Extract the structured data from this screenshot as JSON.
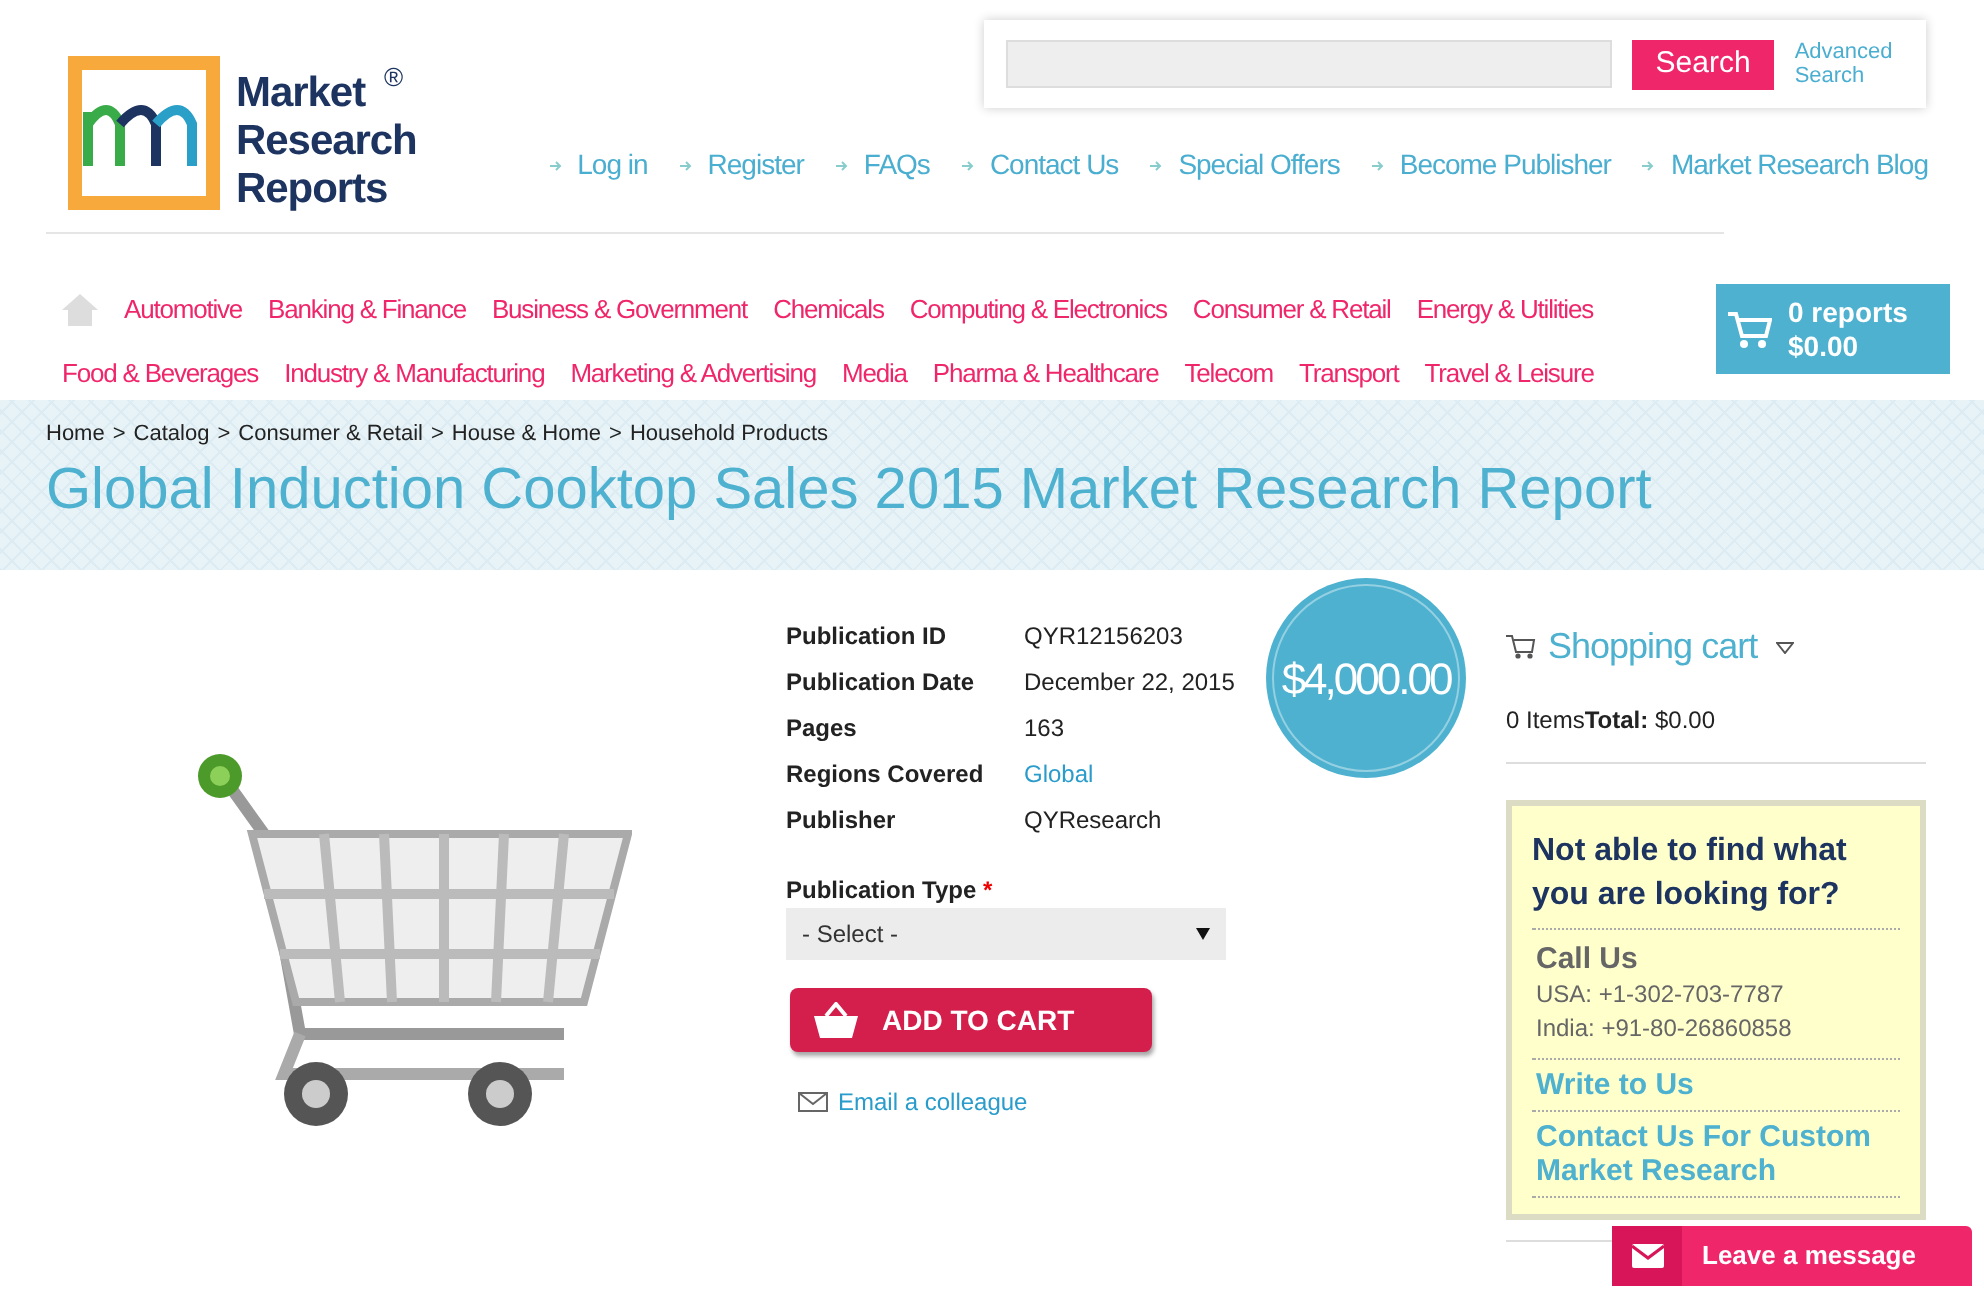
{
  "logo": {
    "line_1": "Market",
    "line_2": "Research",
    "line_3": "Reports",
    "mark": "®"
  },
  "search": {
    "button": "Search",
    "advanced": "Advanced Search"
  },
  "top_links": [
    "Log in",
    "Register",
    "FAQs",
    "Contact Us",
    "Special Offers",
    "Become Publisher",
    "Market Research Blog"
  ],
  "categories": [
    [
      "Automotive",
      "Banking & Finance",
      "Business & Government",
      "Chemicals",
      "Computing & Electronics",
      "Consumer & Retail",
      "Energy & Utilities"
    ],
    [
      "Food & Beverages",
      "Industry & Manufacturing",
      "Marketing & Advertising",
      "Media",
      "Pharma & Healthcare",
      "Telecom",
      "Transport",
      "Travel & Leisure"
    ]
  ],
  "cart_box": {
    "count": "0 reports",
    "total": "$0.00"
  },
  "breadcrumb": [
    "Home",
    ">",
    "Catalog",
    ">",
    "Consumer & Retail",
    ">",
    "House & Home",
    ">",
    "Household Products"
  ],
  "title": "Global Induction Cooktop Sales 2015 Market Research Report",
  "details": [
    {
      "label": "Publication ID",
      "value": "QYR12156203",
      "kind": "text"
    },
    {
      "label": "Publication Date",
      "value": "December 22, 2015",
      "kind": "text"
    },
    {
      "label": "Pages",
      "value": "163",
      "kind": "text"
    },
    {
      "label": "Regions Covered",
      "value": "Global",
      "kind": "link"
    },
    {
      "label": "Publisher",
      "value": "QYResearch",
      "kind": "text"
    }
  ],
  "price": "$4,000.00",
  "publication_type": {
    "label": "Publication Type",
    "required": "*",
    "value": "- Select -"
  },
  "add_to_cart": "ADD TO CART",
  "email_link": "Email a colleague",
  "shopping_cart": {
    "title": "Shopping cart",
    "summary": "0 Items**Total:** $0.00"
  },
  "help_box": {
    "heading": "Not able to find what you are looking for?",
    "call_title": "Call Us",
    "phones": [
      "USA: +1-302-703-7787",
      "India: +91-80-26860858"
    ],
    "links": [
      "Write to Us",
      "Contact Us For Custom Market Research"
    ]
  },
  "chat": "Leave a message"
}
